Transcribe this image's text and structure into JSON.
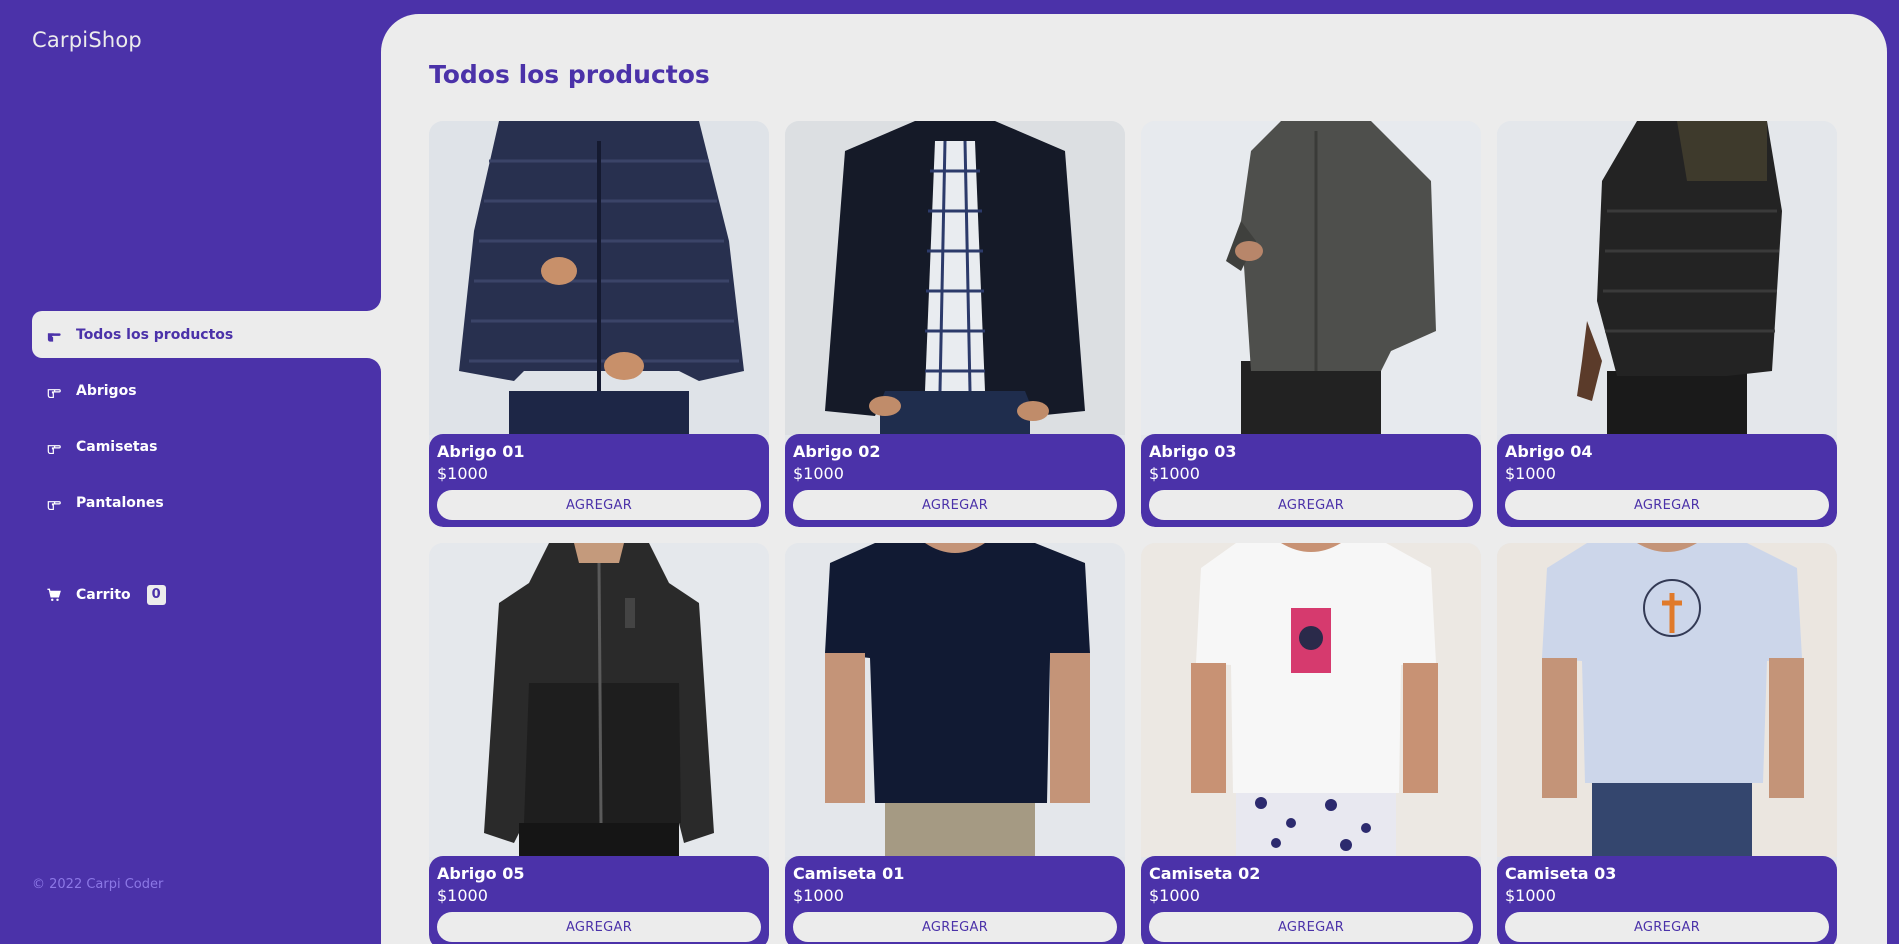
{
  "brand": {
    "name": "CarpiShop"
  },
  "nav": {
    "items": [
      {
        "label": "Todos los productos",
        "active": true,
        "icon": "hand-pointing-icon"
      },
      {
        "label": "Abrigos",
        "active": false,
        "icon": "hand-pointing-icon"
      },
      {
        "label": "Camisetas",
        "active": false,
        "icon": "hand-pointing-icon"
      },
      {
        "label": "Pantalones",
        "active": false,
        "icon": "hand-pointing-icon"
      }
    ],
    "cart": {
      "label": "Carrito",
      "count": "0",
      "icon": "cart-icon"
    }
  },
  "footer": {
    "text": "© 2022 Carpi Coder"
  },
  "main": {
    "title": "Todos los productos",
    "products": [
      {
        "name": "Abrigo 01",
        "price": "$1000",
        "button": "AGREGAR",
        "image": "puffer-jacket-navy"
      },
      {
        "name": "Abrigo 02",
        "price": "$1000",
        "button": "AGREGAR",
        "image": "black-jacket-plaid-shirt"
      },
      {
        "name": "Abrigo 03",
        "price": "$1000",
        "button": "AGREGAR",
        "image": "grey-jacket"
      },
      {
        "name": "Abrigo 04",
        "price": "$1000",
        "button": "AGREGAR",
        "image": "black-puffer-jacket"
      },
      {
        "name": "Abrigo 05",
        "price": "$1000",
        "button": "AGREGAR",
        "image": "black-hoodie-jacket"
      },
      {
        "name": "Camiseta 01",
        "price": "$1000",
        "button": "AGREGAR",
        "image": "navy-tshirt"
      },
      {
        "name": "Camiseta 02",
        "price": "$1000",
        "button": "AGREGAR",
        "image": "white-tshirt-print"
      },
      {
        "name": "Camiseta 03",
        "price": "$1000",
        "button": "AGREGAR",
        "image": "lightblue-tshirt-print"
      }
    ]
  },
  "colors": {
    "primary": "#4b32a9",
    "surface": "#ececec",
    "footer_text": "#8c78e6"
  }
}
